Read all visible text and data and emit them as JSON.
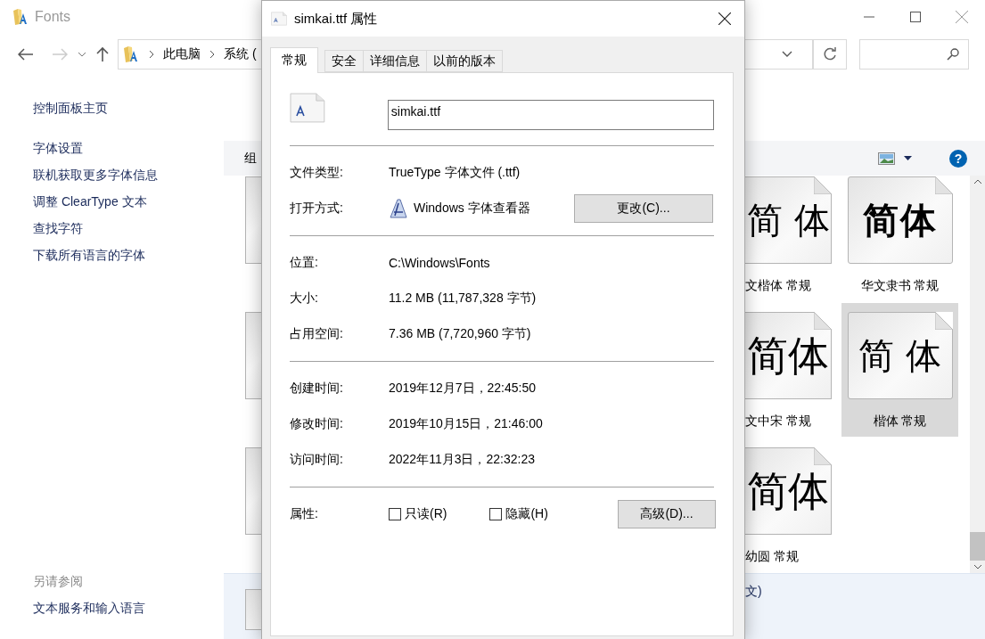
{
  "explorer": {
    "title": "Fonts",
    "breadcrumb": [
      "此电脑",
      "系统 ("
    ],
    "sidebar": {
      "home": "控制面板主页",
      "links": [
        "字体设置",
        "联机获取更多字体信息",
        "调整 ClearType 文本",
        "查找字符",
        "下载所有语言的字体"
      ],
      "see_also": {
        "heading": "另请参阅",
        "links": [
          "文本服务和输入语言"
        ]
      }
    },
    "toolbar": {
      "organize": "组",
      "help": "?"
    },
    "font_rows": [
      {
        "tiles": [
          {
            "sample": "简 体",
            "label": "文楷体 常规",
            "kind": "regular",
            "selected": false
          },
          {
            "sample": "简体",
            "label": "华文隶书 常规",
            "kind": "bold",
            "selected": false
          }
        ]
      },
      {
        "tiles": [
          {
            "sample": "简体",
            "label": "文中宋 常规",
            "kind": "large",
            "selected": false
          },
          {
            "sample": "简 体",
            "label": "楷体 常规",
            "kind": "regular",
            "selected": true
          }
        ]
      },
      {
        "tiles": [
          {
            "sample": "简体",
            "label": "幼圆 常规",
            "kind": "large",
            "selected": false
          }
        ]
      }
    ],
    "details_pane": {
      "text": "文)"
    }
  },
  "dialog": {
    "title": "simkai.ttf 属性",
    "tabs": [
      {
        "label": "常规",
        "selected": true
      },
      {
        "label": "安全",
        "selected": false
      },
      {
        "label": "详细信息",
        "selected": false
      },
      {
        "label": "以前的版本",
        "selected": false
      }
    ],
    "file_name": "simkai.ttf",
    "sections": [
      [
        {
          "kind": "text",
          "label": "文件类型:",
          "value": "TrueType 字体文件 (.ttf)"
        },
        {
          "kind": "app",
          "label": "打开方式:",
          "value": "Windows 字体查看器",
          "button": "更改(C)..."
        }
      ],
      [
        {
          "kind": "text",
          "label": "位置:",
          "value": "C:\\Windows\\Fonts"
        },
        {
          "kind": "text",
          "label": "大小:",
          "value": "11.2 MB (11,787,328 字节)"
        },
        {
          "kind": "text",
          "label": "占用空间:",
          "value": "7.36 MB (7,720,960 字节)"
        }
      ],
      [
        {
          "kind": "text",
          "label": "创建时间:",
          "value": "2019年12月7日，22:45:50"
        },
        {
          "kind": "text",
          "label": "修改时间:",
          "value": "2019年10月15日，21:46:00"
        },
        {
          "kind": "text",
          "label": "访问时间:",
          "value": "2022年11月3日，22:32:23"
        }
      ],
      [
        {
          "kind": "attributes",
          "label": "属性:",
          "checkboxes": [
            {
              "label": "只读(R)",
              "checked": false
            },
            {
              "label": "隐藏(H)",
              "checked": false
            }
          ],
          "button": "高级(D)..."
        }
      ]
    ]
  }
}
